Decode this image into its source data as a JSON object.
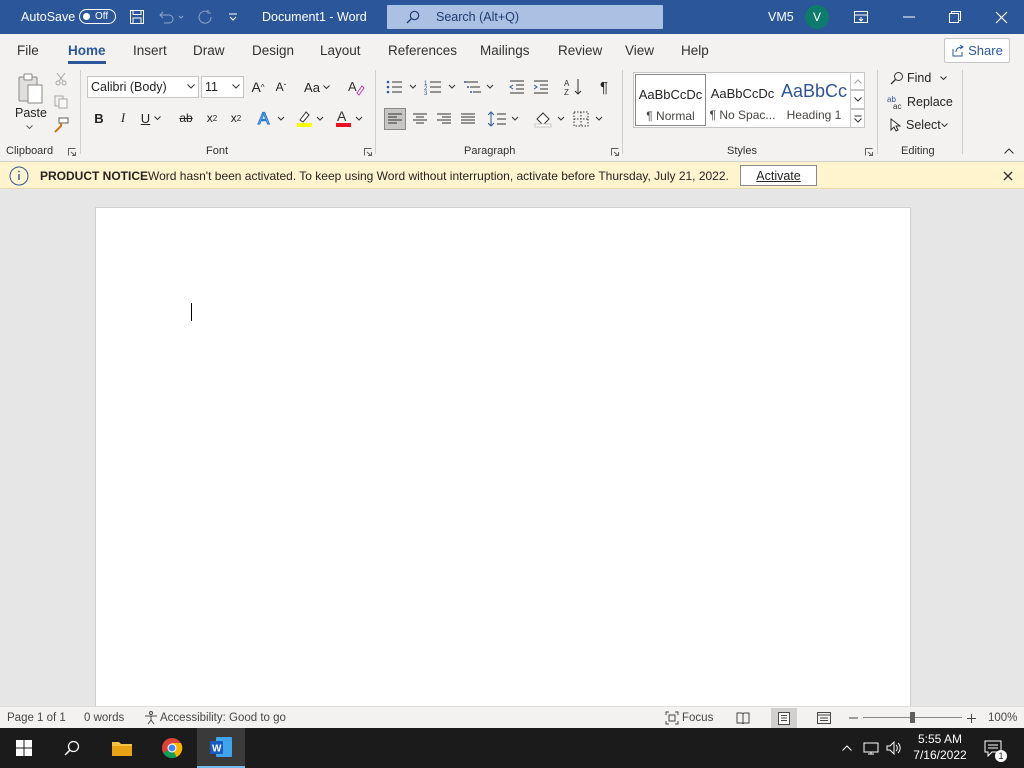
{
  "title_bar": {
    "autosave_label": "AutoSave",
    "autosave_state": "Off",
    "document_title": "Document1 - Word",
    "search_placeholder": "Search (Alt+Q)",
    "user_name": "VM5",
    "avatar_initial": "V"
  },
  "tabs": [
    "File",
    "Home",
    "Insert",
    "Draw",
    "Design",
    "Layout",
    "References",
    "Mailings",
    "Review",
    "View",
    "Help"
  ],
  "active_tab": "Home",
  "share_label": "Share",
  "ribbon": {
    "clipboard": {
      "label": "Clipboard",
      "paste_label": "Paste"
    },
    "font": {
      "label": "Font",
      "font_name": "Calibri (Body)",
      "font_size": "11"
    },
    "paragraph": {
      "label": "Paragraph"
    },
    "styles": {
      "label": "Styles",
      "items": [
        {
          "preview": "AaBbCcDc",
          "name": "¶ Normal"
        },
        {
          "preview": "AaBbCcDc",
          "name": "¶ No Spac..."
        },
        {
          "preview": "AaBbCc",
          "name": "Heading 1"
        }
      ]
    },
    "editing": {
      "label": "Editing",
      "find": "Find",
      "replace": "Replace",
      "select": "Select"
    }
  },
  "notice": {
    "title": "PRODUCT NOTICE",
    "message": "Word hasn't been activated. To keep using Word without interruption, activate before Thursday, July 21, 2022.",
    "button": "Activate"
  },
  "status_bar": {
    "page": "Page 1 of 1",
    "words": "0 words",
    "accessibility": "Accessibility: Good to go",
    "focus": "Focus",
    "zoom": "100%"
  },
  "taskbar": {
    "time": "5:55 AM",
    "date": "7/16/2022",
    "notification_count": "1"
  },
  "colors": {
    "brand": "#2b579a",
    "notice_bg": "#fff4ce",
    "taskbar": "#1b1b1b"
  }
}
